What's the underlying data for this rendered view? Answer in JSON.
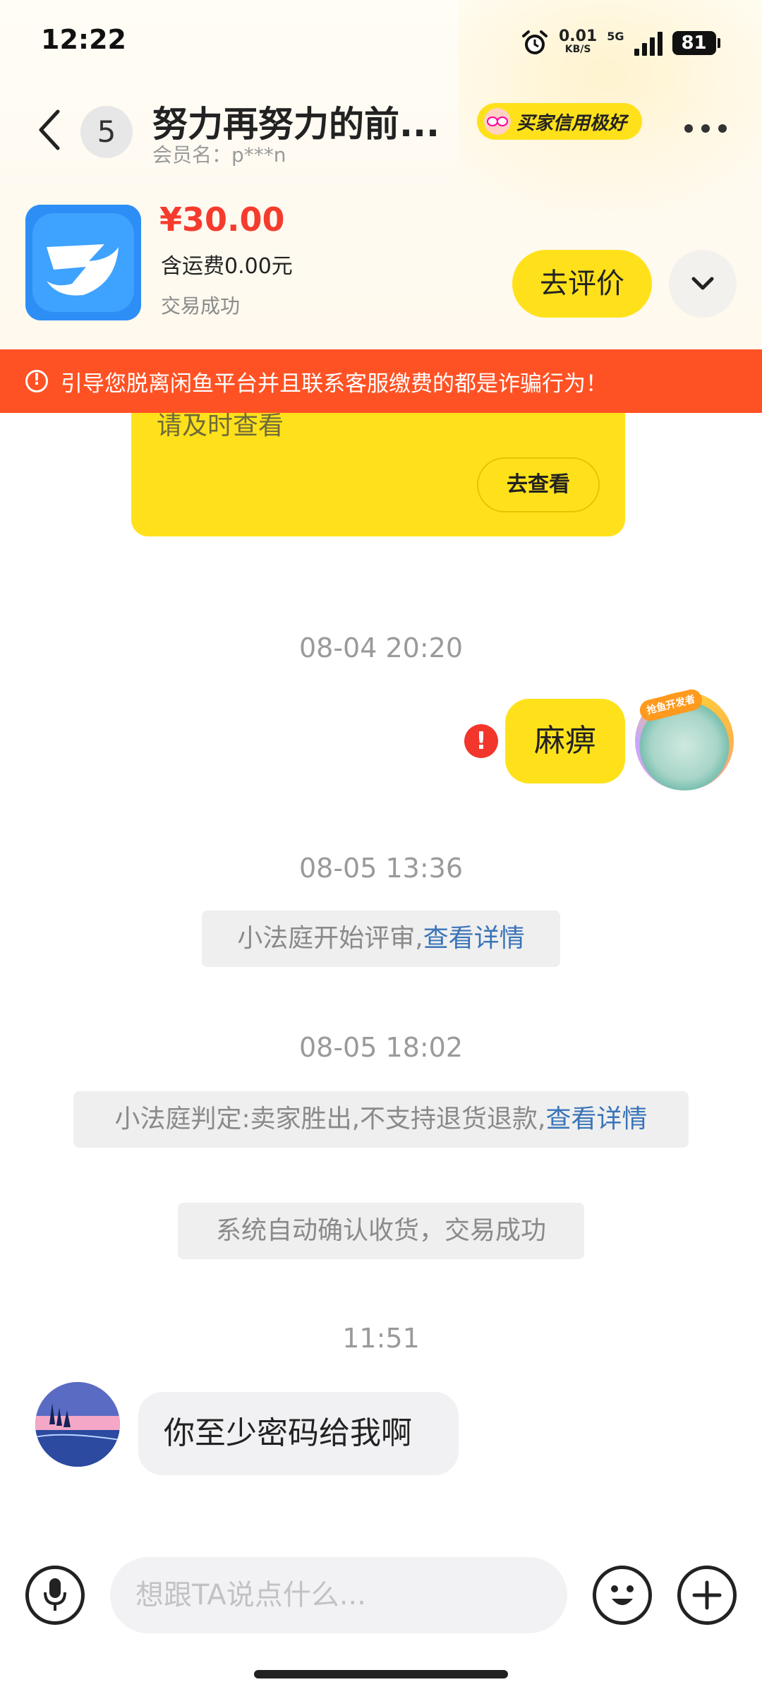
{
  "status_bar": {
    "time": "12:22",
    "net_speed": "0.01",
    "net_unit": "KB/S",
    "network": "5G",
    "battery": "81"
  },
  "header": {
    "unread_count": "5",
    "title": "努力再努力的前...",
    "member": "会员名：p***n",
    "credit_badge": "买家信用极好"
  },
  "product": {
    "price": "¥30.00",
    "shipping": "含运费0.00元",
    "status": "交易成功",
    "review_button": "去评价"
  },
  "warning": {
    "text": "引导您脱离闲鱼平台并且联系客服缴费的都是诈骗行为！"
  },
  "notice_card": {
    "text": "请及时查看",
    "button": "去查看"
  },
  "chat": {
    "ts1": "08-04 20:20",
    "my_message": "麻痹",
    "my_avatar_badge": "抢鱼开发者",
    "ts2": "08-05 13:36",
    "sys1_text": "小法庭开始评审,",
    "sys1_link": "查看详情",
    "ts3": "08-05 18:02",
    "sys2_text": "小法庭判定:卖家胜出,不支持退货退款,",
    "sys2_link": "查看详情",
    "sys3_text": "系统自动确认收货，交易成功",
    "ts4": "11:51",
    "peer_message": "你至少密码给我啊"
  },
  "input_bar": {
    "placeholder": "想跟TA说点什么..."
  },
  "colors": {
    "accent_yellow": "#ffe11b",
    "warning_orange": "#ff5224",
    "price_red": "#f53b2e",
    "link_blue": "#3a74b8"
  }
}
